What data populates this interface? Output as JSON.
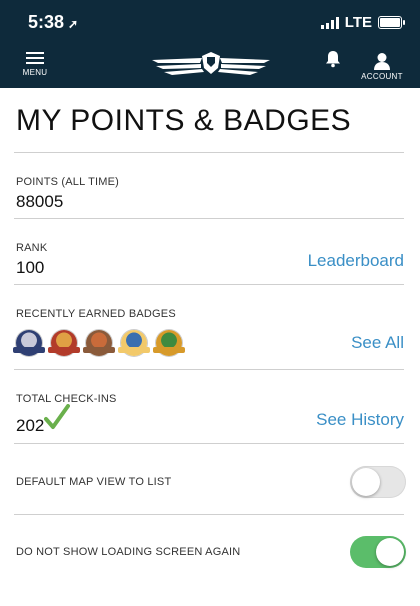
{
  "status_bar": {
    "time": "5:38",
    "carrier": "LTE"
  },
  "nav": {
    "menu_label": "MENU",
    "account_label": "ACCOUNT",
    "logo_icon": "winged-logo-icon"
  },
  "page": {
    "title": "MY POINTS & BADGES"
  },
  "points": {
    "label": "POINTS (ALL TIME)",
    "value": "88005"
  },
  "rank": {
    "label": "RANK",
    "value": "100",
    "link": "Leaderboard"
  },
  "badges": {
    "label": "RECENTLY EARNED BADGES",
    "link": "See All",
    "items": [
      {
        "name": "badge-1",
        "color": "#2f3f73",
        "accent": "#c9c9d9"
      },
      {
        "name": "badge-2",
        "color": "#b23b2a",
        "accent": "#e0a044"
      },
      {
        "name": "badge-3",
        "color": "#8a5a3a",
        "accent": "#c96b3a"
      },
      {
        "name": "badge-4",
        "color": "#f2c96a",
        "accent": "#3a6fb0"
      },
      {
        "name": "badge-5",
        "color": "#d79a2a",
        "accent": "#3f8a3f"
      }
    ]
  },
  "checkins": {
    "label": "TOTAL CHECK-INS",
    "value": "202",
    "link": "See History",
    "check_color": "#6ab04c"
  },
  "settings": [
    {
      "label": "DEFAULT MAP VIEW TO LIST",
      "on": false
    },
    {
      "label": "DO NOT SHOW LOADING SCREEN AGAIN",
      "on": true
    }
  ]
}
